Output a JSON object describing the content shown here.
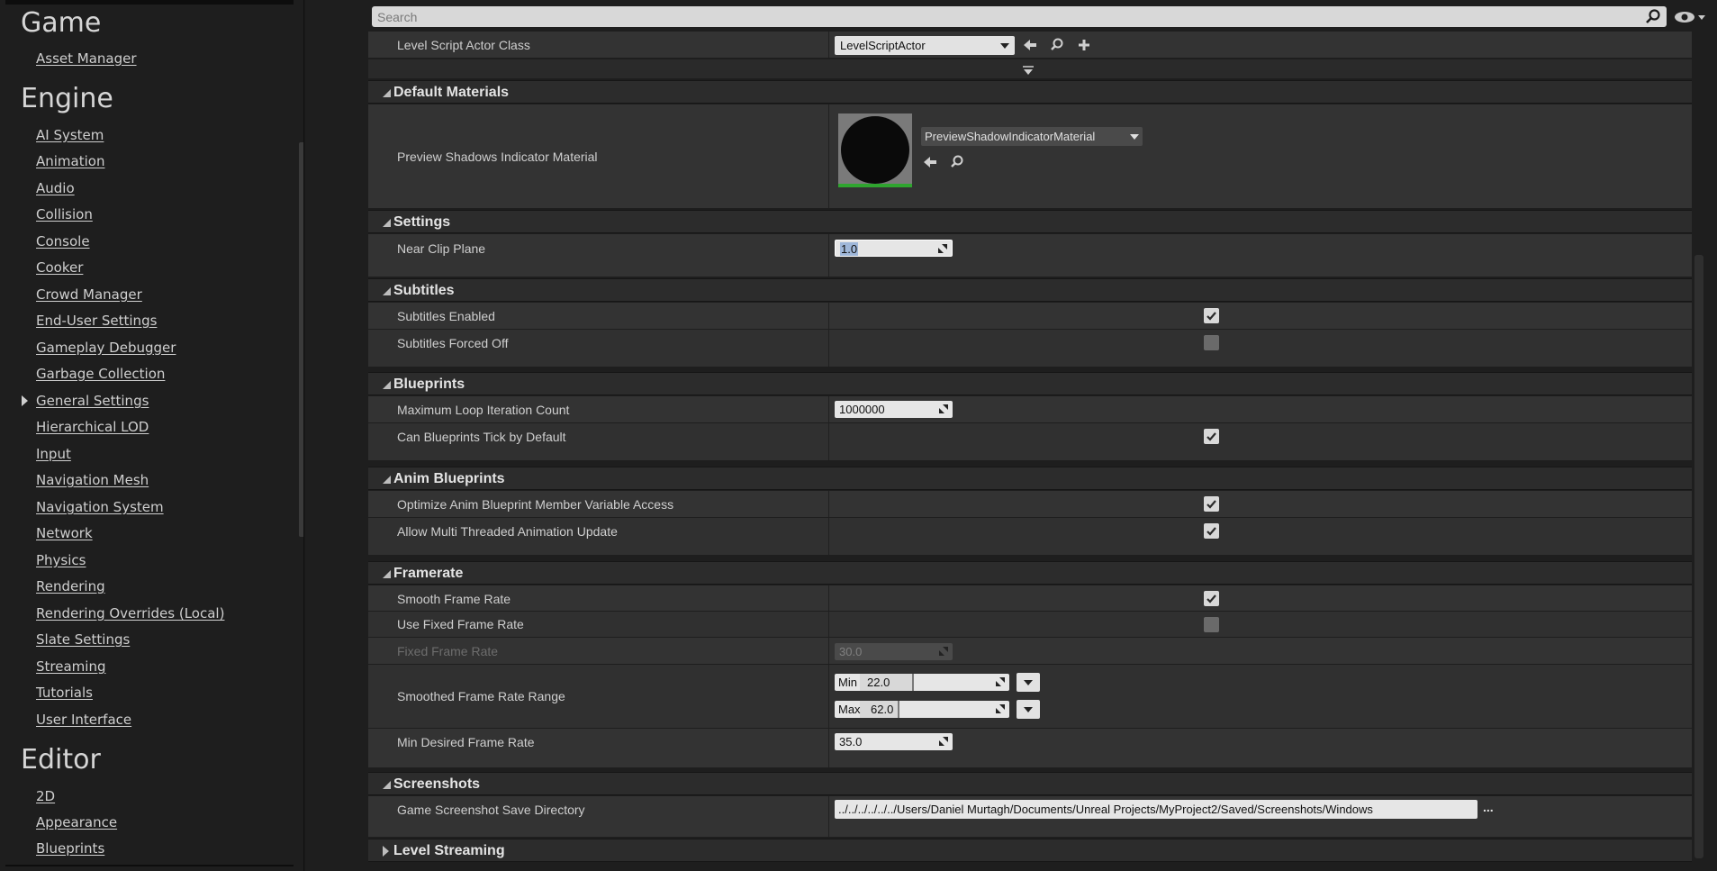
{
  "sidebar": {
    "sections": [
      {
        "title": "Game",
        "items": [
          {
            "label": "Asset Manager"
          }
        ]
      },
      {
        "title": "Engine",
        "items": [
          {
            "label": "AI System"
          },
          {
            "label": "Animation"
          },
          {
            "label": "Audio"
          },
          {
            "label": "Collision"
          },
          {
            "label": "Console"
          },
          {
            "label": "Cooker"
          },
          {
            "label": "Crowd Manager"
          },
          {
            "label": "End-User Settings"
          },
          {
            "label": "Gameplay Debugger"
          },
          {
            "label": "Garbage Collection"
          },
          {
            "label": "General Settings"
          },
          {
            "label": "Hierarchical LOD"
          },
          {
            "label": "Input"
          },
          {
            "label": "Navigation Mesh"
          },
          {
            "label": "Navigation System"
          },
          {
            "label": "Network"
          },
          {
            "label": "Physics"
          },
          {
            "label": "Rendering"
          },
          {
            "label": "Rendering Overrides (Local)"
          },
          {
            "label": "Slate Settings"
          },
          {
            "label": "Streaming"
          },
          {
            "label": "Tutorials"
          },
          {
            "label": "User Interface"
          }
        ]
      },
      {
        "title": "Editor",
        "items": [
          {
            "label": "2D"
          },
          {
            "label": "Appearance"
          },
          {
            "label": "Blueprints"
          }
        ]
      }
    ]
  },
  "search": {
    "placeholder": "Search"
  },
  "details": {
    "level_script": {
      "label": "Level Script Actor Class",
      "value": "LevelScriptActor"
    },
    "default_materials": {
      "title": "Default Materials",
      "preview_shadows": {
        "label": "Preview Shadows Indicator Material",
        "value": "PreviewShadowIndicatorMaterial"
      }
    },
    "settings": {
      "title": "Settings",
      "near_clip": {
        "label": "Near Clip Plane",
        "value": "1.0"
      }
    },
    "subtitles": {
      "title": "Subtitles",
      "enabled": {
        "label": "Subtitles Enabled",
        "checked": true
      },
      "forced_off": {
        "label": "Subtitles Forced Off",
        "checked": false
      }
    },
    "blueprints": {
      "title": "Blueprints",
      "max_loop": {
        "label": "Maximum Loop Iteration Count",
        "value": "1000000"
      },
      "tick_default": {
        "label": "Can Blueprints Tick by Default",
        "checked": true
      }
    },
    "anim_blueprints": {
      "title": "Anim Blueprints",
      "optimize": {
        "label": "Optimize Anim Blueprint Member Variable Access",
        "checked": true
      },
      "multithread": {
        "label": "Allow Multi Threaded Animation Update",
        "checked": true
      }
    },
    "framerate": {
      "title": "Framerate",
      "smooth": {
        "label": "Smooth Frame Rate",
        "checked": true
      },
      "use_fixed": {
        "label": "Use Fixed Frame Rate",
        "checked": false
      },
      "fixed": {
        "label": "Fixed Frame Rate",
        "value": "30.0"
      },
      "smoothed_range": {
        "label": "Smoothed Frame Rate Range",
        "min_label": "Min",
        "min_value": "22.0",
        "max_label": "Max",
        "max_value": "62.0"
      },
      "min_desired": {
        "label": "Min Desired Frame Rate",
        "value": "35.0"
      }
    },
    "screenshots": {
      "title": "Screenshots",
      "save_dir": {
        "label": "Game Screenshot Save Directory",
        "value": "../../../../../../Users/Daniel Murtagh/Documents/Unreal Projects/MyProject2/Saved/Screenshots/Windows",
        "more": "..."
      }
    },
    "level_streaming": {
      "title": "Level Streaming"
    }
  },
  "colors": {
    "checkmark": "#2a2a2a",
    "thumbnail_border": "#2fa52f",
    "selection": "#9fb7d9"
  }
}
